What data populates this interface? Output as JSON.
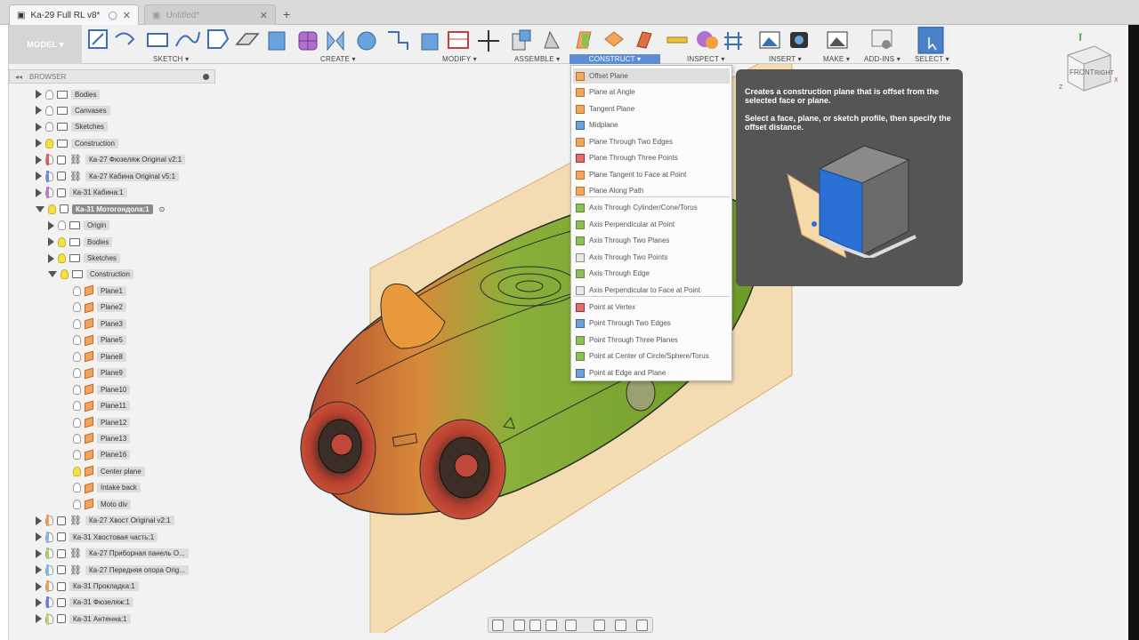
{
  "tabs": [
    {
      "title": "Ka-29 Full RL v8*",
      "active": true
    },
    {
      "title": "Untitled*",
      "active": false
    }
  ],
  "toolbar": {
    "model": "MODEL ▾",
    "groups": [
      "SKETCH ▾",
      "CREATE ▾",
      "MODIFY ▾",
      "ASSEMBLE ▾",
      "CONSTRUCT ▾",
      "INSPECT ▾",
      "INSERT ▾",
      "MAKE ▾",
      "ADD-INS ▾",
      "SELECT ▾"
    ]
  },
  "browser": {
    "title": "BROWSER",
    "items": [
      {
        "label": "Bodies",
        "depth": 1,
        "icon": "folder",
        "open": false
      },
      {
        "label": "Canvases",
        "depth": 1,
        "icon": "folder",
        "open": false
      },
      {
        "label": "Sketches",
        "depth": 1,
        "icon": "folder",
        "open": false
      },
      {
        "label": "Construction",
        "depth": 1,
        "icon": "folder",
        "open": false,
        "bulb": true
      },
      {
        "label": "Ка-27 Фюзеляж Original v2:1",
        "depth": 1,
        "icon": "link",
        "open": false,
        "color": "#e06060"
      },
      {
        "label": "Ка-27 Кабина Original v5:1",
        "depth": 1,
        "icon": "link",
        "open": false,
        "color": "#6a8fd8"
      },
      {
        "label": "Ка-31 Кабина:1",
        "depth": 1,
        "icon": "comp",
        "open": false,
        "color": "#c07ad0"
      },
      {
        "label": "Ка-31 Мотогондола:1",
        "depth": 1,
        "icon": "comp",
        "open": true,
        "selected": true,
        "bulb": true
      },
      {
        "label": "Origin",
        "depth": 2,
        "icon": "folder",
        "open": false
      },
      {
        "label": "Bodies",
        "depth": 2,
        "icon": "folder",
        "open": false,
        "bulb": true
      },
      {
        "label": "Sketches",
        "depth": 2,
        "icon": "folder",
        "open": false,
        "bulb": true
      },
      {
        "label": "Construction",
        "depth": 2,
        "icon": "folder",
        "open": true,
        "bulb": true
      },
      {
        "label": "Plane1",
        "depth": 3,
        "icon": "plane"
      },
      {
        "label": "Plane2",
        "depth": 3,
        "icon": "plane"
      },
      {
        "label": "Plane3",
        "depth": 3,
        "icon": "plane"
      },
      {
        "label": "Plane5",
        "depth": 3,
        "icon": "plane"
      },
      {
        "label": "Plane8",
        "depth": 3,
        "icon": "plane"
      },
      {
        "label": "Plane9",
        "depth": 3,
        "icon": "plane"
      },
      {
        "label": "Plane10",
        "depth": 3,
        "icon": "plane"
      },
      {
        "label": "Plane11",
        "depth": 3,
        "icon": "plane"
      },
      {
        "label": "Plane12",
        "depth": 3,
        "icon": "plane"
      },
      {
        "label": "Plane13",
        "depth": 3,
        "icon": "plane"
      },
      {
        "label": "Plane16",
        "depth": 3,
        "icon": "plane"
      },
      {
        "label": "Center plane",
        "depth": 3,
        "icon": "plane",
        "bulb": true
      },
      {
        "label": "Intake back",
        "depth": 3,
        "icon": "plane"
      },
      {
        "label": "Moto div",
        "depth": 3,
        "icon": "plane"
      },
      {
        "label": "Ка-27 Хвост Original v2:1",
        "depth": 1,
        "icon": "link",
        "open": false,
        "color": "#f0a050"
      },
      {
        "label": "Ка-31 Хвостовая часть:1",
        "depth": 1,
        "icon": "comp",
        "open": false,
        "color": "#8ab8e0"
      },
      {
        "label": "Ка-27 Приборная панель О...",
        "depth": 1,
        "icon": "link",
        "open": false,
        "color": "#a6d070"
      },
      {
        "label": "Ка-27 Передняя опора Orig...",
        "depth": 1,
        "icon": "link",
        "open": false,
        "color": "#7ec0d8"
      },
      {
        "label": "Ка-31 Прокладка:1",
        "depth": 1,
        "icon": "comp",
        "open": false,
        "color": "#f0a050"
      },
      {
        "label": "Ка-31 Фюзеляж:1",
        "depth": 1,
        "icon": "comp",
        "open": false,
        "color": "#6a7fd8"
      },
      {
        "label": "Ка-31 Антенна:1",
        "depth": 1,
        "icon": "comp",
        "open": false,
        "color": "#c8d060"
      }
    ]
  },
  "construct_menu": {
    "groups": [
      [
        {
          "label": "Offset Plane",
          "icon": "o",
          "hover": true
        },
        {
          "label": "Plane at Angle",
          "icon": "o"
        },
        {
          "label": "Tangent Plane",
          "icon": "o"
        },
        {
          "label": "Midplane",
          "icon": "b"
        },
        {
          "label": "Plane Through Two Edges",
          "icon": "o"
        },
        {
          "label": "Plane Through Three Points",
          "icon": "r"
        },
        {
          "label": "Plane Tangent to Face at Point",
          "icon": "o"
        },
        {
          "label": "Plane Along Path",
          "icon": "o"
        }
      ],
      [
        {
          "label": "Axis Through Cylinder/Cone/Torus",
          "icon": "g"
        },
        {
          "label": "Axis Perpendicular at Point",
          "icon": "g"
        },
        {
          "label": "Axis Through Two Planes",
          "icon": "g"
        },
        {
          "label": "Axis Through Two Points",
          "icon": ""
        },
        {
          "label": "Axis Through Edge",
          "icon": "g"
        },
        {
          "label": "Axis Perpendicular to Face at Point",
          "icon": ""
        }
      ],
      [
        {
          "label": "Point at Vertex",
          "icon": "r"
        },
        {
          "label": "Point Through Two Edges",
          "icon": "b"
        },
        {
          "label": "Point Through Three Planes",
          "icon": "g"
        },
        {
          "label": "Point at Center of Circle/Sphere/Torus",
          "icon": "g"
        },
        {
          "label": "Point at Edge and Plane",
          "icon": "b"
        }
      ]
    ]
  },
  "tooltip": {
    "line1": "Creates a construction plane that is offset from the selected face or plane.",
    "line2": "Select a face, plane, or sketch profile, then specify the offset distance."
  },
  "viewcube": {
    "front": "FRONT",
    "right": "RIGHT",
    "x": "X",
    "y": "Y",
    "z": "Z"
  },
  "colors": {
    "accent": "#5b8ed4",
    "plane": "#f5d9a8",
    "body_green": "#7aa830",
    "body_orange": "#e89a3a",
    "intake_red": "#c84838"
  }
}
